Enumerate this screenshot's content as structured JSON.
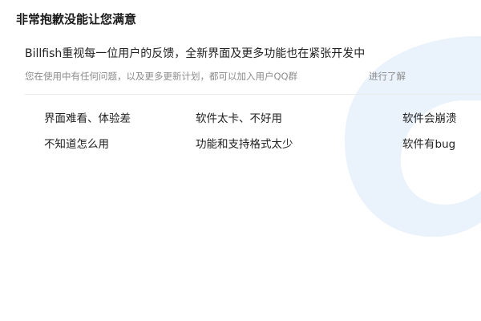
{
  "dialog": {
    "title": "非常抱歉没能让您满意"
  },
  "message": {
    "headline": "Billfish重视每一位用户的反馈，全新界面及更多功能也在紧张开发中",
    "subtext": "您在使用中有任何问题，以及更多更新计划，都可以加入用户QQ群",
    "plan_link": "进行了解"
  },
  "reasons": [
    {
      "label": "界面难看、体验差"
    },
    {
      "label": "软件太卡、不好用"
    },
    {
      "label": "软件会崩溃"
    },
    {
      "label": "不知道怎么用"
    },
    {
      "label": "功能和支持格式太少"
    },
    {
      "label": "软件有bug"
    }
  ],
  "background": {
    "icon": "billfish-logo-icon",
    "color": "#eaf2fc"
  }
}
